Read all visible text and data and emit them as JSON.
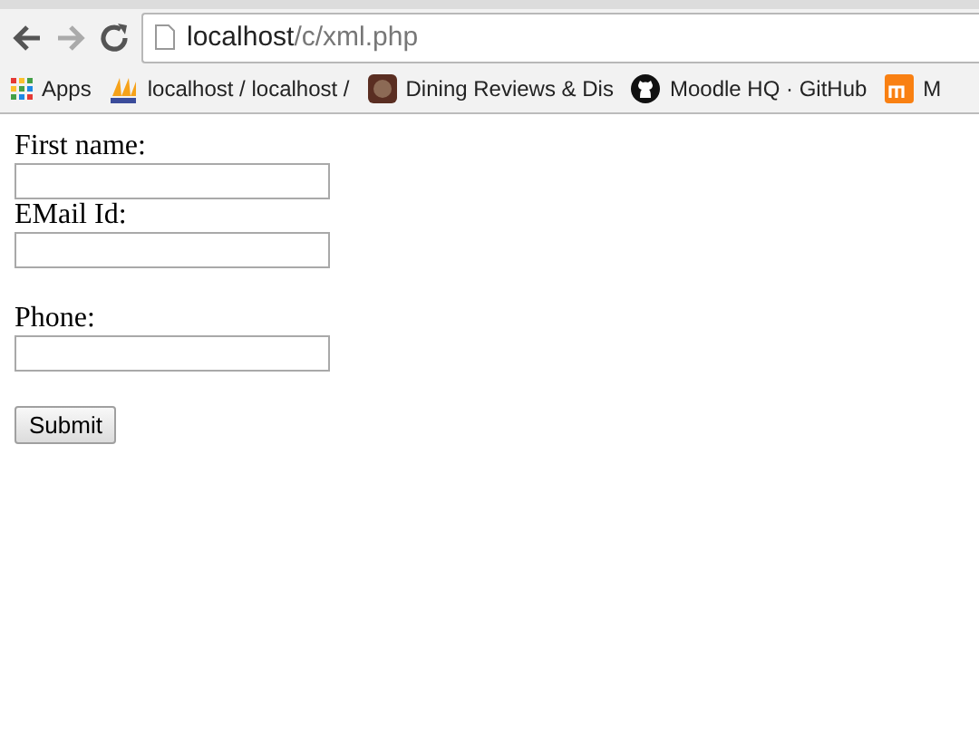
{
  "address_bar": {
    "host": "localhost",
    "path": "/c/xml.php"
  },
  "bookmarks": [
    {
      "label": "Apps",
      "kind": "apps"
    },
    {
      "label": "localhost / localhost /",
      "kind": "pma"
    },
    {
      "label": "Dining Reviews & Dis",
      "kind": "dining"
    },
    {
      "label": "Moodle HQ · GitHub",
      "kind": "github"
    },
    {
      "label": "M",
      "kind": "moodle"
    }
  ],
  "form": {
    "items": [
      {
        "kind": "field",
        "label": "First name:"
      },
      {
        "kind": "field",
        "label": "EMail Id:"
      },
      {
        "kind": "blank_line"
      },
      {
        "kind": "field",
        "label": "Phone:"
      },
      {
        "kind": "blank_line"
      },
      {
        "kind": "submit",
        "label": "Submit"
      }
    ]
  }
}
